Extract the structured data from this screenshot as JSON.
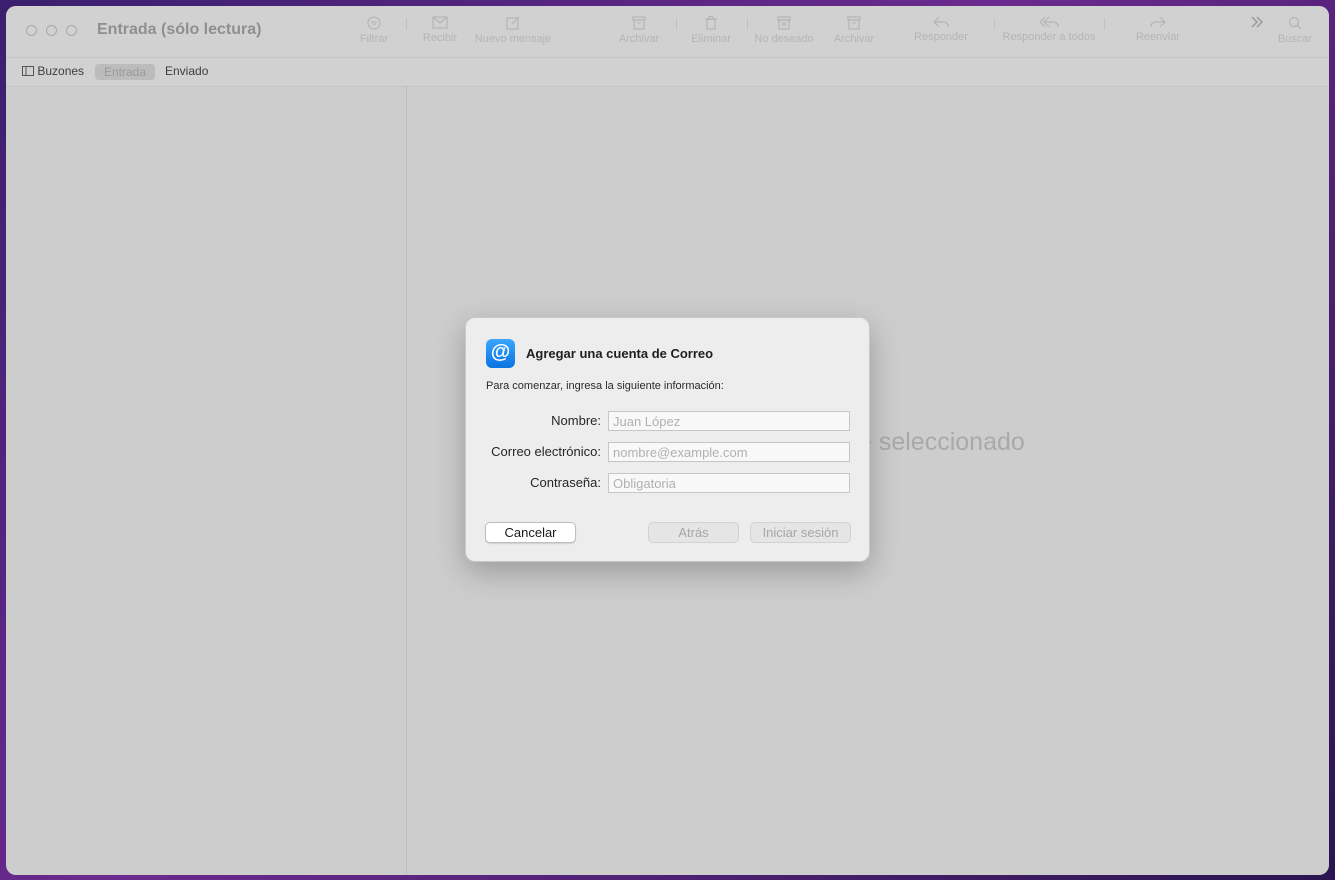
{
  "window": {
    "title": "Entrada (sólo lectura)"
  },
  "toolbar": {
    "items": [
      {
        "label": "Filtrar",
        "icon": "filter-icon"
      },
      {
        "label": "Recibir",
        "icon": "envelope-icon"
      },
      {
        "label": "Nuevo mensaje",
        "icon": "compose-icon"
      },
      {
        "label": "Archivar",
        "icon": "archive-icon"
      },
      {
        "label": "Eliminar",
        "icon": "trash-icon"
      },
      {
        "label": "No deseado",
        "icon": "junk-icon"
      },
      {
        "label": "Archivar",
        "icon": "archive-icon"
      },
      {
        "label": "Responder",
        "icon": "reply-icon"
      },
      {
        "label": "Responder a todos",
        "icon": "reply-all-icon"
      },
      {
        "label": "Reenviar",
        "icon": "forward-icon"
      },
      {
        "label": "Buscar",
        "icon": "search-icon"
      }
    ]
  },
  "tabs": {
    "mailboxes": "Buzones",
    "inbox": "Entrada",
    "sent": "Enviado"
  },
  "main": {
    "empty_message": "e seleccionado"
  },
  "dialog": {
    "title": "Agregar una cuenta de Correo",
    "subtitle": "Para comenzar, ingresa la siguiente información:",
    "icon_glyph": "@",
    "fields": {
      "name_label": "Nombre:",
      "name_placeholder": "Juan López",
      "email_label": "Correo electrónico:",
      "email_placeholder": "nombre@example.com",
      "password_label": "Contraseña:",
      "password_placeholder": "Obligatoria"
    },
    "buttons": {
      "cancel": "Cancelar",
      "back": "Atrás",
      "signin": "Iniciar sesión"
    }
  },
  "colors": {
    "accent": "#0a74e0",
    "window_bg": "#cdcdcd",
    "dialog_bg": "#ededed"
  }
}
